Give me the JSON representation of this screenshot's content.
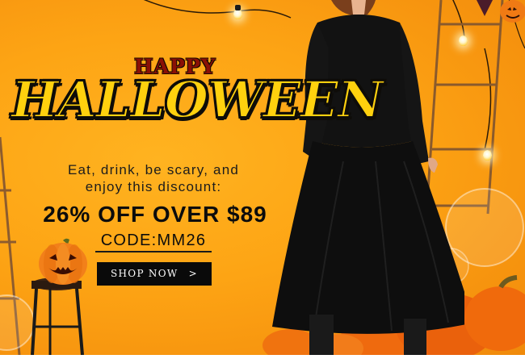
{
  "banner": {
    "happy": "HAPPY",
    "halloween": "HALLOWEEN",
    "tagline_line1": "Eat, drink, be scary, and",
    "tagline_line2": "enjoy this discount:",
    "offer": "26% OFF OVER $89",
    "code": "CODE:MM26",
    "cta_label": "SHOP NOW",
    "cta_arrow": ">"
  },
  "colors": {
    "background": "#fda414",
    "title_yellow": "#ffd10e",
    "title_red": "#8a1006",
    "button_bg": "#0a0a0a",
    "button_text": "#ffffff",
    "dress": "#111111",
    "pumpkin": "#f06a0c"
  },
  "icons": {
    "jack_o_lantern": "jack-o-lantern-icon",
    "arrow": "chevron-right-icon"
  }
}
